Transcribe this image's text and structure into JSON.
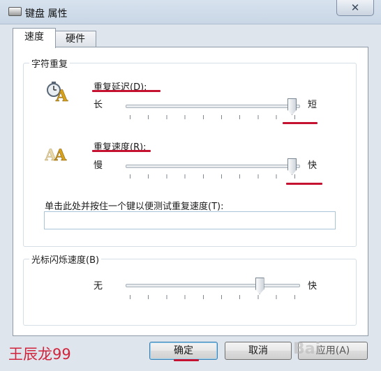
{
  "window": {
    "title": "键盘 属性",
    "close_glyph": "✕"
  },
  "tabs": [
    {
      "label": "速度"
    },
    {
      "label": "硬件"
    }
  ],
  "repeat_group": {
    "title": "字符重复",
    "delay": {
      "label": "重复延迟(D):",
      "left": "长",
      "right": "短",
      "value_fraction": 1.0
    },
    "rate": {
      "label": "重复速度(R):",
      "left": "慢",
      "right": "快",
      "value_fraction": 1.0
    },
    "test_label": "单击此处并按住一个键以便测试重复速度(T):",
    "test_value": ""
  },
  "cursor_group": {
    "title": "光标闪烁速度(B)",
    "left": "无",
    "right": "快",
    "value_fraction": 0.8
  },
  "buttons": {
    "ok": "确定",
    "cancel": "取消",
    "apply": "应用(A)"
  },
  "watermark": "王辰龙99",
  "brand_mark": "Bai",
  "colors": {
    "annotation_red": "#c41230"
  }
}
